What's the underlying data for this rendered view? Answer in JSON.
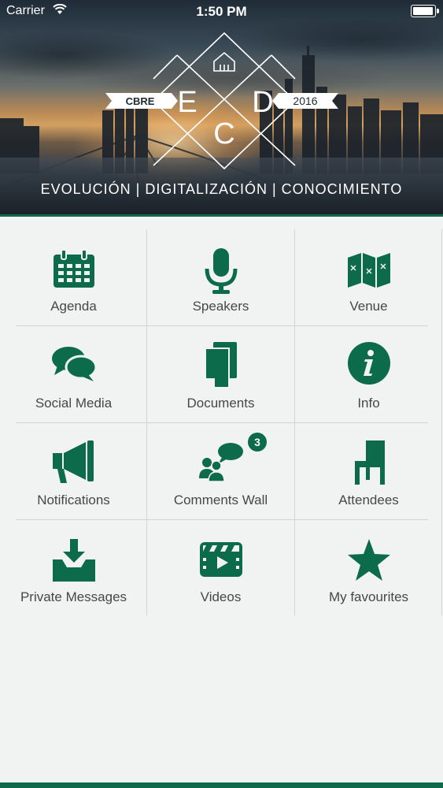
{
  "status_bar": {
    "carrier": "Carrier",
    "time": "1:50 PM"
  },
  "hero": {
    "logo_letters": [
      "E",
      "D",
      "C"
    ],
    "left_ribbon": "CBRE",
    "right_ribbon": "2016",
    "tagline": "EVOLUCIÓN | DIGITALIZACIÓN | CONOCIMIENTO"
  },
  "menu": [
    {
      "label": "Agenda",
      "icon": "calendar-icon"
    },
    {
      "label": "Speakers",
      "icon": "microphone-icon"
    },
    {
      "label": "Venue",
      "icon": "map-icon"
    },
    {
      "label": "Social Media",
      "icon": "chat-bubbles-icon"
    },
    {
      "label": "Documents",
      "icon": "documents-icon"
    },
    {
      "label": "Info",
      "icon": "info-icon"
    },
    {
      "label": "Notifications",
      "icon": "megaphone-icon"
    },
    {
      "label": "Comments Wall",
      "icon": "people-chat-icon",
      "badge": "3"
    },
    {
      "label": "Attendees",
      "icon": "chair-icon"
    },
    {
      "label": "Private Messages",
      "icon": "inbox-download-icon"
    },
    {
      "label": "Videos",
      "icon": "video-icon"
    },
    {
      "label": "My favourites",
      "icon": "star-icon"
    }
  ],
  "colors": {
    "accent": "#0b6b4b",
    "label_text": "#474747",
    "background": "#f1f2f2",
    "divider": "#d2d4d4"
  }
}
